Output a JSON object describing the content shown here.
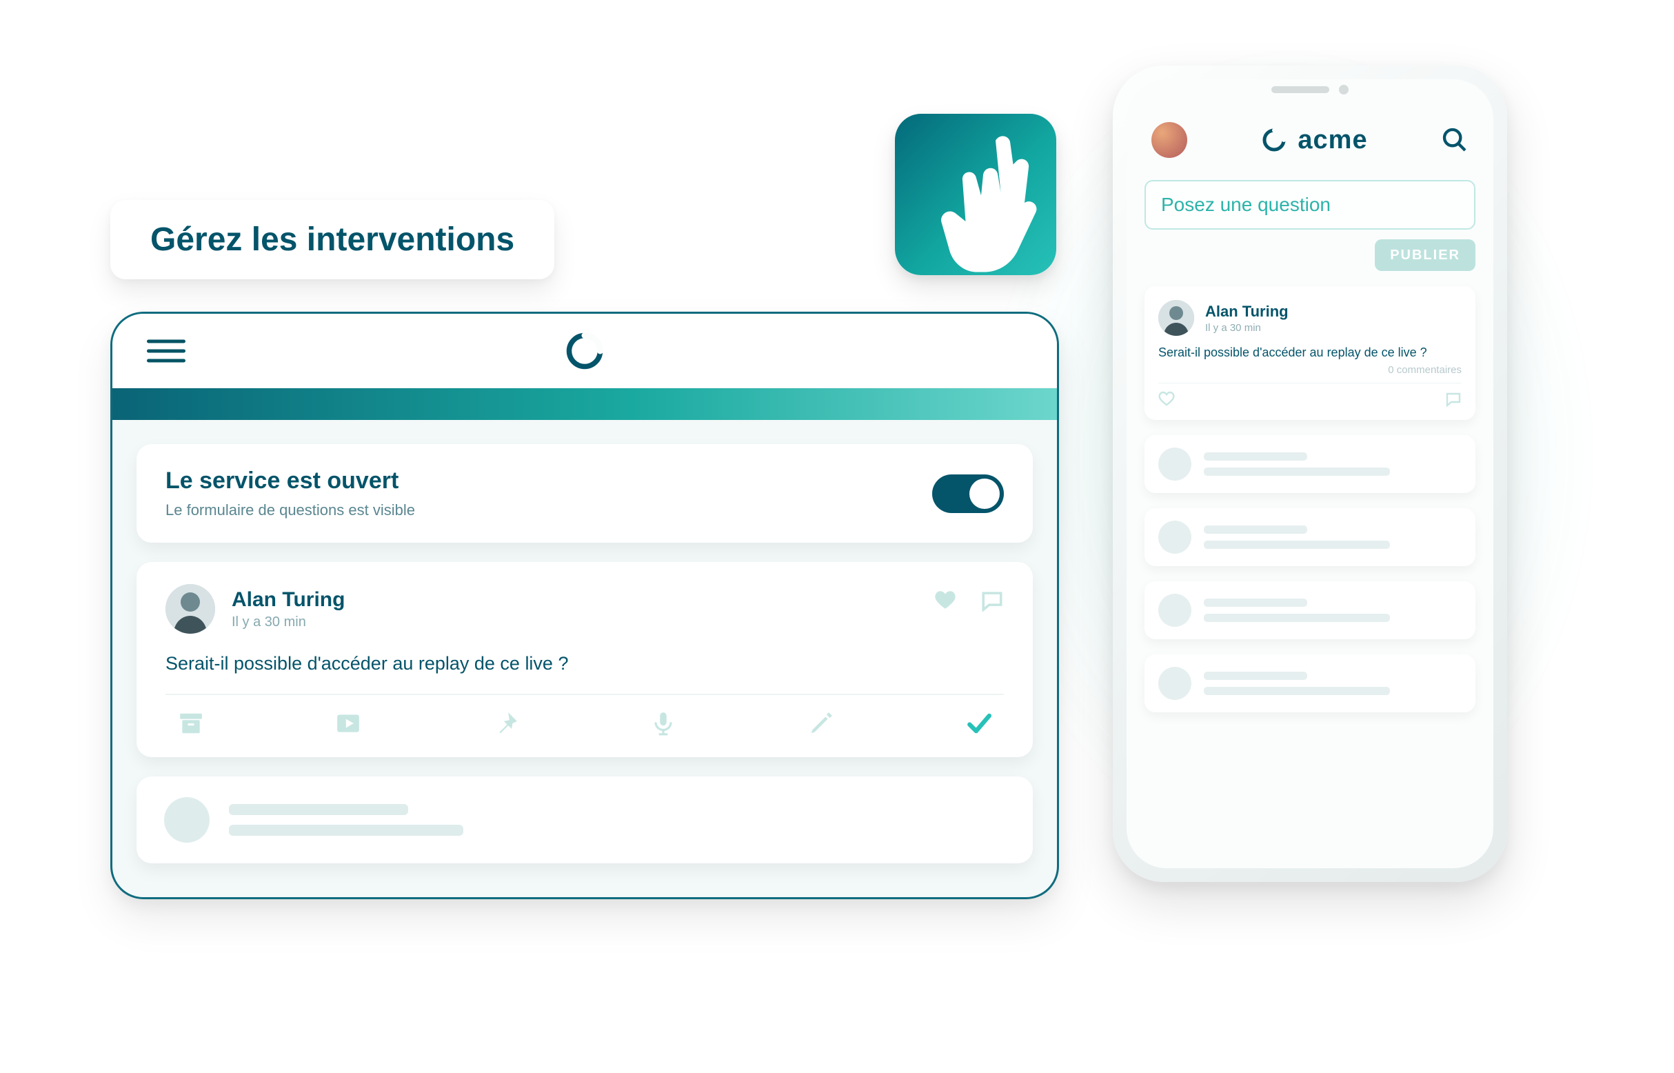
{
  "heading": "Gérez les interventions",
  "tablet": {
    "status": {
      "title": "Le service est ouvert",
      "subtitle": "Le formulaire de questions est visible",
      "enabled": true
    },
    "question": {
      "author": "Alan Turing",
      "time": "Il y a 30 min",
      "text": "Serait-il possible d'accéder au replay de ce live ?"
    }
  },
  "phone": {
    "brand": "acme",
    "ask_placeholder": "Posez une question",
    "publish_label": "PUBLIER",
    "feed_item": {
      "author": "Alan Turing",
      "time": "Il y a 30 min",
      "text": "Serait-il possible d'accéder au replay de ce live ?",
      "comments_meta": "0 commentaires"
    }
  },
  "colors": {
    "primary": "#04546a",
    "accent": "#27c1b8"
  }
}
